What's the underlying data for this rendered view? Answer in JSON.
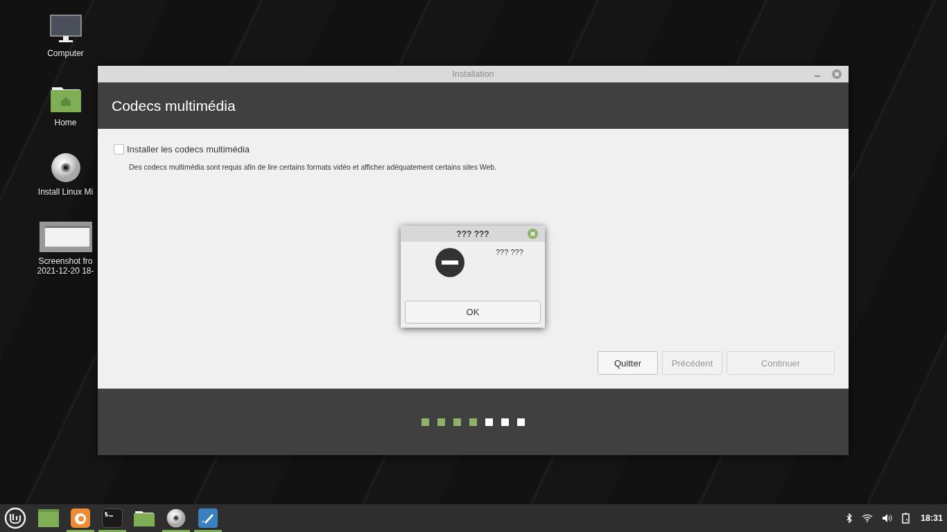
{
  "desktop_icons": [
    {
      "kind": "computer",
      "label": "Computer"
    },
    {
      "kind": "home",
      "label": "Home"
    },
    {
      "kind": "disc",
      "label": "Install Linux Mi"
    },
    {
      "kind": "screenshot",
      "label": "Screenshot fro",
      "label_2": "2021-12-20 18-"
    }
  ],
  "window": {
    "title": "Installation",
    "heading": "Codecs multimédia",
    "option": {
      "label": "Installer les codecs multimédia",
      "checked": false
    },
    "description": "Des codecs multimédia sont requis afin de lire certains formats vidéo et afficher adéquatement certains sites Web.",
    "buttons": [
      {
        "label": "Quitter",
        "disabled": false
      },
      {
        "label": "Précédent",
        "disabled": true
      },
      {
        "label": "Continuer",
        "disabled": true
      }
    ],
    "steps": [
      {
        "done": true
      },
      {
        "done": true
      },
      {
        "done": true
      },
      {
        "done": true
      },
      {
        "done": false
      },
      {
        "done": false
      },
      {
        "done": false
      }
    ]
  },
  "dialog": {
    "title": "???  ???",
    "message": "???  ???",
    "button": "OK"
  },
  "taskbar": {
    "apps": [
      {
        "kind": "window",
        "running": false
      },
      {
        "kind": "firefox",
        "running": true
      },
      {
        "kind": "terminal",
        "running": true
      },
      {
        "kind": "folder",
        "running": false
      },
      {
        "kind": "disc",
        "running": true
      },
      {
        "kind": "editor",
        "running": true
      }
    ],
    "clock": "18:31"
  }
}
